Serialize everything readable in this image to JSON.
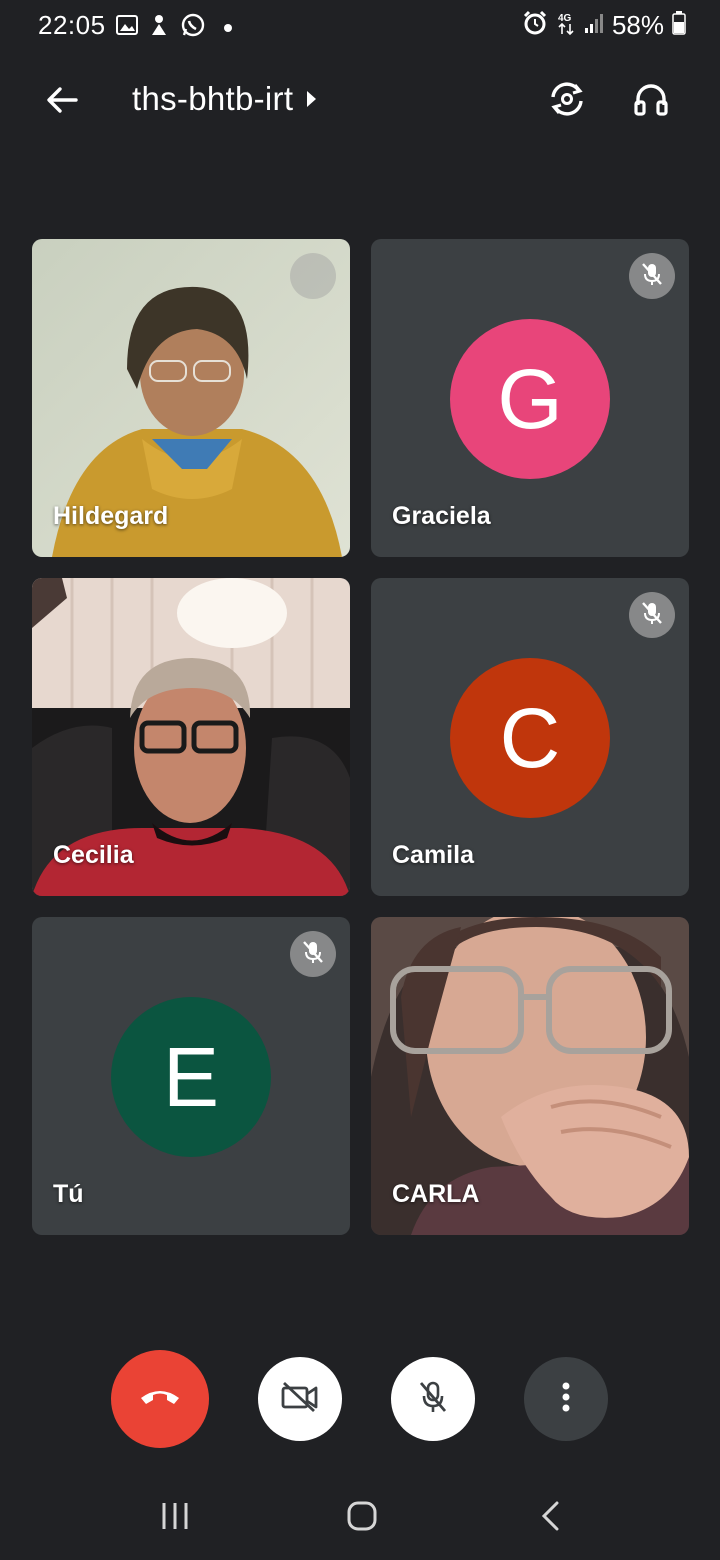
{
  "status_bar": {
    "time": "22:05",
    "battery": "58%",
    "icons": [
      "gallery-icon",
      "notification-icon",
      "whatsapp-icon",
      "dot-icon",
      "alarm-icon",
      "4g-icon",
      "signal-icon",
      "battery-icon"
    ]
  },
  "header": {
    "meeting_code": "ths-bhtb-irt",
    "icons": [
      "back-arrow-icon",
      "switch-camera-icon",
      "headphones-icon"
    ]
  },
  "participants": [
    {
      "name": "Hildegard",
      "type": "video",
      "muted": false
    },
    {
      "name": "Graciela",
      "type": "avatar",
      "initial": "G",
      "avatar_color": "#e8457a",
      "muted": true
    },
    {
      "name": "Cecilia",
      "type": "video",
      "muted": false
    },
    {
      "name": "Camila",
      "type": "avatar",
      "initial": "C",
      "avatar_color": "#c0360c",
      "muted": true
    },
    {
      "name": "Tú",
      "type": "avatar",
      "initial": "E",
      "avatar_color": "#0b5540",
      "muted": true
    },
    {
      "name": "CARLA",
      "type": "video",
      "muted": false
    }
  ],
  "controls": {
    "icons": [
      "end-call-icon",
      "camera-off-icon",
      "mic-off-icon",
      "more-vert-icon"
    ],
    "end_call_color": "#ea4335"
  },
  "navigation": {
    "icons": [
      "recents-icon",
      "home-icon",
      "back-icon"
    ]
  }
}
